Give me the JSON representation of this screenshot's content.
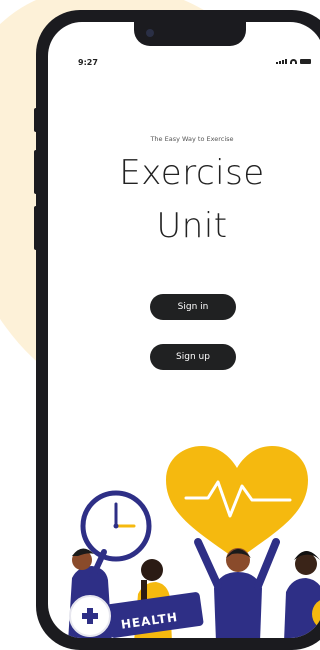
{
  "status_bar": {
    "time": "9:27"
  },
  "welcome": {
    "tagline": "The Easy Way to Exercise",
    "title_line1": "Exercise",
    "title_line2": "Unit"
  },
  "buttons": {
    "sign_in": "Sign in",
    "sign_up": "Sign up"
  },
  "illustration": {
    "banner_text": "HEALTH",
    "plus_symbol": "+"
  },
  "colors": {
    "background_blob": "#fdf1d8",
    "phone_frame": "#1b1b1f",
    "button": "#202122",
    "heart": "#f5b90f",
    "people": "#2e2f86",
    "banner": "#2e2f86"
  }
}
